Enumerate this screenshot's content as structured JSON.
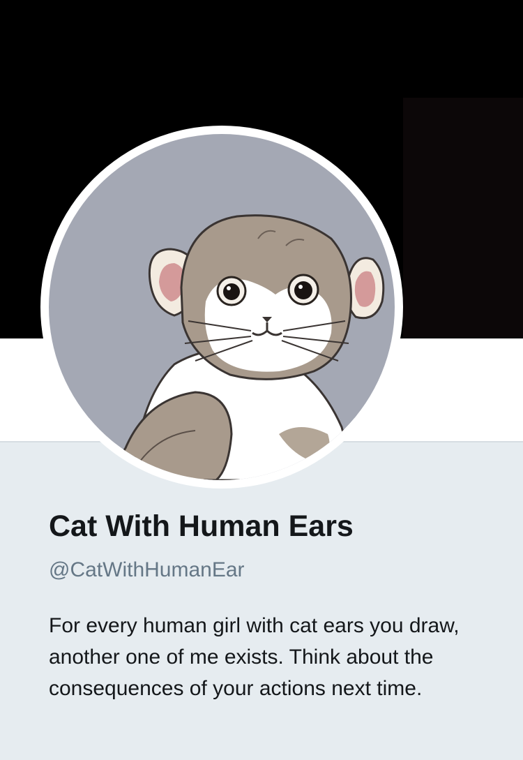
{
  "profile": {
    "display_name": "Cat With Human Ears",
    "handle": "@CatWithHumanEar",
    "bio": "For every human girl with cat ears you draw, another one of me exists. Think about the consequences of your actions next time."
  },
  "colors": {
    "banner": "#000000",
    "page_background": "#e6ecf0",
    "header_strip": "#ffffff",
    "avatar_background": "#a4a8b4",
    "name_text": "#14171a",
    "handle_text": "#657786"
  },
  "avatar": {
    "icon": "cat-with-human-ears-illustration"
  }
}
